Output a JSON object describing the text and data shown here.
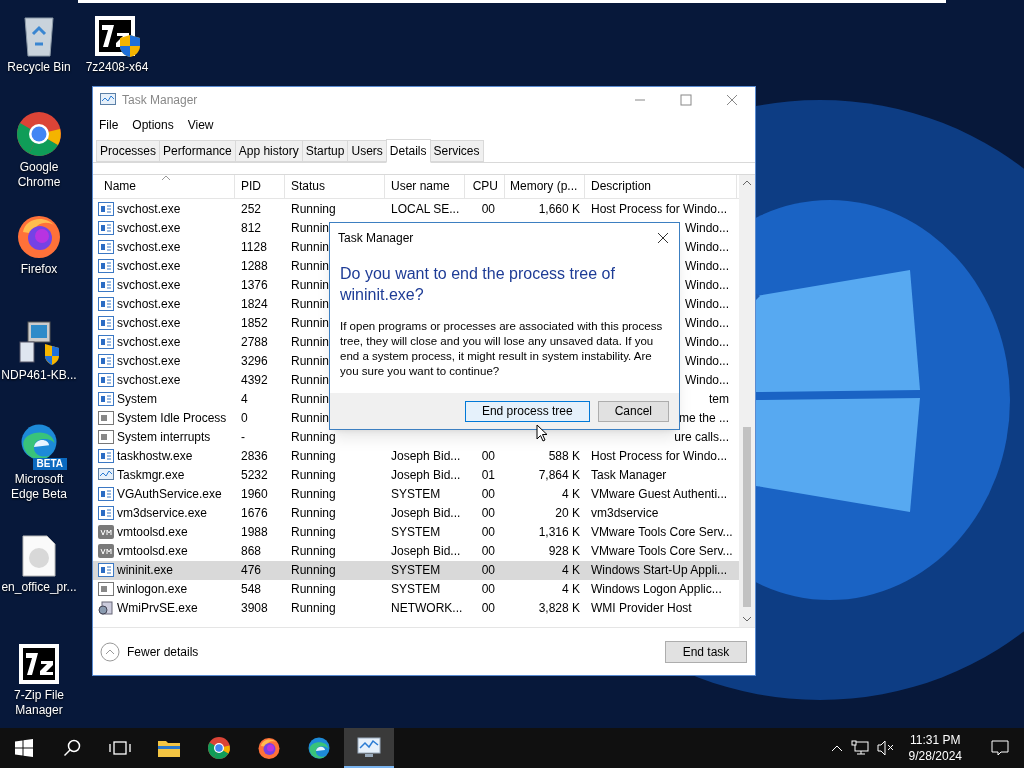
{
  "desktop_icons": [
    {
      "label": "Recycle Bin",
      "kind": "recycle"
    },
    {
      "label": "7z2408-x64",
      "kind": "sevenzip-setup"
    },
    {
      "label": "Google Chrome",
      "kind": "chrome"
    },
    {
      "label": "Firefox",
      "kind": "firefox"
    },
    {
      "label": "NDP461-KB...",
      "kind": "setup"
    },
    {
      "label": "Microsoft Edge Beta",
      "kind": "edge",
      "badge": "BETA"
    },
    {
      "label": "en_office_pr...",
      "kind": "disc"
    },
    {
      "label": "7-Zip File Manager",
      "kind": "sevenzip"
    }
  ],
  "window": {
    "title": "Task Manager",
    "menu": [
      "File",
      "Options",
      "View"
    ],
    "tabs": [
      {
        "label": "Processes",
        "selected": false
      },
      {
        "label": "Performance",
        "selected": false
      },
      {
        "label": "App history",
        "selected": false
      },
      {
        "label": "Startup",
        "selected": false
      },
      {
        "label": "Users",
        "selected": false
      },
      {
        "label": "Details",
        "selected": true
      },
      {
        "label": "Services",
        "selected": false
      }
    ],
    "table": {
      "columns": [
        "Name",
        "PID",
        "Status",
        "User name",
        "CPU",
        "Memory (p...",
        "Description"
      ],
      "rows": [
        {
          "kind": "service",
          "name": "svchost.exe",
          "pid": "252",
          "status": "Running",
          "user": "LOCAL SE...",
          "cpu": "00",
          "memory": "1,660 K",
          "description": "Host Process for Windo...",
          "selected": false
        },
        {
          "kind": "service",
          "name": "svchost.exe",
          "pid": "812",
          "status": "Runnin",
          "description": "Windo...",
          "selected": false
        },
        {
          "kind": "service",
          "name": "svchost.exe",
          "pid": "1128",
          "status": "Runnin",
          "description": "Windo...",
          "selected": false
        },
        {
          "kind": "service",
          "name": "svchost.exe",
          "pid": "1288",
          "status": "Runnin",
          "description": "Windo...",
          "selected": false
        },
        {
          "kind": "service",
          "name": "svchost.exe",
          "pid": "1376",
          "status": "Runnin",
          "description": "Windo...",
          "selected": false
        },
        {
          "kind": "service",
          "name": "svchost.exe",
          "pid": "1824",
          "status": "Runnin",
          "description": "Windo...",
          "selected": false
        },
        {
          "kind": "service",
          "name": "svchost.exe",
          "pid": "1852",
          "status": "Runnin",
          "description": "Windo...",
          "selected": false
        },
        {
          "kind": "service",
          "name": "svchost.exe",
          "pid": "2788",
          "status": "Runnin",
          "description": "Windo...",
          "selected": false
        },
        {
          "kind": "service",
          "name": "svchost.exe",
          "pid": "3296",
          "status": "Runnin",
          "description": "Windo...",
          "selected": false
        },
        {
          "kind": "service",
          "name": "svchost.exe",
          "pid": "4392",
          "status": "Runnin",
          "description": "Windo...",
          "selected": false
        },
        {
          "kind": "service",
          "name": "System",
          "pid": "4",
          "status": "Runnin",
          "description": "tem",
          "selected": false
        },
        {
          "kind": "system",
          "name": "System Idle Process",
          "pid": "0",
          "status": "Runnin",
          "description": "me the ...",
          "selected": false
        },
        {
          "kind": "system",
          "name": "System interrupts",
          "pid": "-",
          "status": "Running",
          "description": "ure calls...",
          "selected": false
        },
        {
          "kind": "service",
          "name": "taskhostw.exe",
          "pid": "2836",
          "status": "Running",
          "user": "Joseph Bid...",
          "cpu": "00",
          "memory": "588 K",
          "description": "Host Process for Windo...",
          "selected": false
        },
        {
          "kind": "taskmgr",
          "name": "Taskmgr.exe",
          "pid": "5232",
          "status": "Running",
          "user": "Joseph Bid...",
          "cpu": "01",
          "memory": "7,864 K",
          "description": "Task Manager",
          "selected": false
        },
        {
          "kind": "service",
          "name": "VGAuthService.exe",
          "pid": "1960",
          "status": "Running",
          "user": "SYSTEM",
          "cpu": "00",
          "memory": "4 K",
          "description": "VMware Guest Authenti...",
          "selected": false
        },
        {
          "kind": "service",
          "name": "vm3dservice.exe",
          "pid": "1676",
          "status": "Running",
          "user": "Joseph Bid...",
          "cpu": "00",
          "memory": "20 K",
          "description": "vm3dservice",
          "selected": false
        },
        {
          "kind": "vm",
          "name": "vmtoolsd.exe",
          "pid": "1988",
          "status": "Running",
          "user": "SYSTEM",
          "cpu": "00",
          "memory": "1,316 K",
          "description": "VMware Tools Core Serv...",
          "selected": false
        },
        {
          "kind": "vm",
          "name": "vmtoolsd.exe",
          "pid": "868",
          "status": "Running",
          "user": "Joseph Bid...",
          "cpu": "00",
          "memory": "928 K",
          "description": "VMware Tools Core Serv...",
          "selected": false
        },
        {
          "kind": "service",
          "name": "wininit.exe",
          "pid": "476",
          "status": "Running",
          "user": "SYSTEM",
          "cpu": "00",
          "memory": "4 K",
          "description": "Windows Start-Up Appli...",
          "selected": true
        },
        {
          "kind": "system",
          "name": "winlogon.exe",
          "pid": "548",
          "status": "Running",
          "user": "SYSTEM",
          "cpu": "00",
          "memory": "4 K",
          "description": "Windows Logon Applic...",
          "selected": false
        },
        {
          "kind": "wmi",
          "name": "WmiPrvSE.exe",
          "pid": "3908",
          "status": "Running",
          "user": "NETWORK...",
          "cpu": "00",
          "memory": "3,828 K",
          "description": "WMI Provider Host",
          "selected": false
        }
      ]
    },
    "fewer_details": "Fewer details",
    "end_task": "End task"
  },
  "dialog": {
    "title": "Task Manager",
    "heading": "Do you want to end the process tree of wininit.exe?",
    "body": "If open programs or processes are associated with this process tree, they will close and you will lose any unsaved data. If you end a system process, it might result in system instability. Are you sure you want to continue?",
    "buttons": [
      {
        "label": "End process tree",
        "focused": true
      },
      {
        "label": "Cancel",
        "focused": false
      }
    ]
  },
  "taskbar": {
    "apps": [
      {
        "kind": "explorer",
        "active": false
      },
      {
        "kind": "chrome",
        "active": false
      },
      {
        "kind": "firefox",
        "active": false
      },
      {
        "kind": "edge",
        "active": false
      },
      {
        "kind": "taskmgr",
        "active": true
      }
    ],
    "time": "11:31 PM",
    "date": "9/28/2024"
  }
}
